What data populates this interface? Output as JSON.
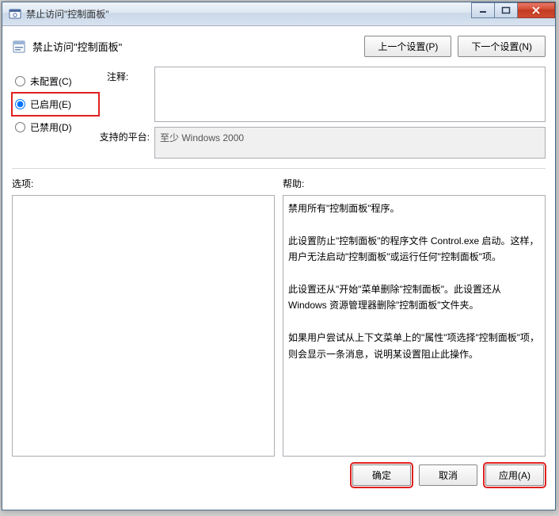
{
  "window": {
    "title": "禁止访问\"控制面板\""
  },
  "header": {
    "title": "禁止访问\"控制面板\"",
    "prev_button": "上一个设置(P)",
    "next_button": "下一个设置(N)"
  },
  "radios": {
    "not_configured": "未配置(C)",
    "enabled": "已启用(E)",
    "disabled": "已禁用(D)",
    "selected": "enabled"
  },
  "fields": {
    "comment_label": "注释:",
    "comment_value": "",
    "platform_label": "支持的平台:",
    "platform_value": "至少 Windows 2000"
  },
  "lower": {
    "options_label": "选项:",
    "options_value": "",
    "help_label": "帮助:",
    "help_value": "禁用所有\"控制面板\"程序。\n\n此设置防止\"控制面板\"的程序文件 Control.exe 启动。这样，用户无法启动\"控制面板\"或运行任何\"控制面板\"项。\n\n此设置还从\"开始\"菜单删除\"控制面板\"。此设置还从 Windows 资源管理器删除\"控制面板\"文件夹。\n\n如果用户尝试从上下文菜单上的\"属性\"项选择\"控制面板\"项，则会显示一条消息，说明某设置阻止此操作。"
  },
  "footer": {
    "ok": "确定",
    "cancel": "取消",
    "apply": "应用(A)"
  }
}
